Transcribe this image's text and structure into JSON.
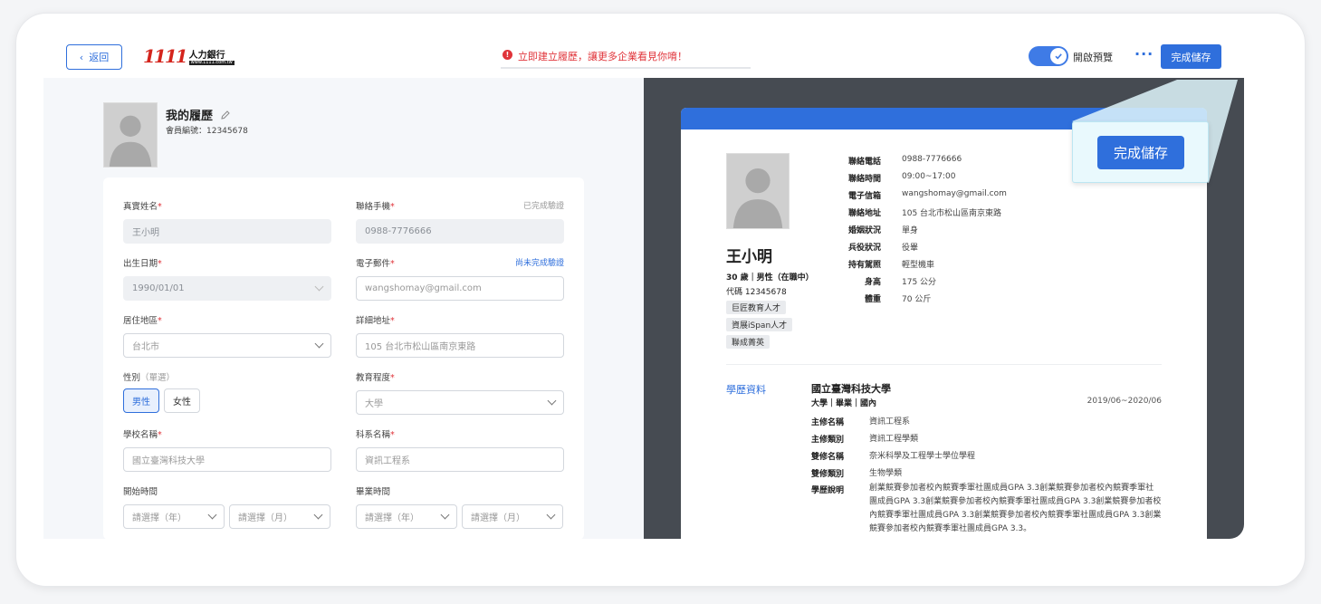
{
  "header": {
    "back_label": "返回",
    "logo_number": "1111",
    "logo_text": "人力銀行",
    "logo_url": "www.1111.com.tw",
    "notice": "立即建立履歷，讓更多企業看見你唷！",
    "preview_toggle_label": "開啟預覽",
    "preview_on": true,
    "more_label": "···",
    "save_label": "完成儲存"
  },
  "profile": {
    "title": "我的履歷",
    "member_id": "會員編號：12345678"
  },
  "form": {
    "name": {
      "label": "真實姓名",
      "value": "王小明"
    },
    "phone": {
      "label": "聯絡手機",
      "status": "已完成驗證",
      "value": "0988-7776666"
    },
    "birthday": {
      "label": "出生日期",
      "value": "1990/01/01"
    },
    "email": {
      "label": "電子郵件",
      "status": "尚未完成驗證",
      "value": "wangshomay@gmail.com"
    },
    "region": {
      "label": "居住地區",
      "value": "台北市"
    },
    "address": {
      "label": "詳細地址",
      "value": "105 台北市松山區南京東路"
    },
    "gender": {
      "label": "性別",
      "hint": "（單選）",
      "options": [
        "男性",
        "女性"
      ],
      "selected": "男性"
    },
    "education": {
      "label": "教育程度",
      "value": "大學"
    },
    "school": {
      "label": "學校名稱",
      "value": "國立臺灣科技大學"
    },
    "department": {
      "label": "科系名稱",
      "value": "資訊工程系"
    },
    "start": {
      "label": "開始時間",
      "year_placeholder": "請選擇（年）",
      "month_placeholder": "請選擇（月）"
    },
    "graduation": {
      "label": "畢業時間",
      "year_placeholder": "請選擇（年）",
      "month_placeholder": "請選擇（月）"
    }
  },
  "preview": {
    "name": "王小明",
    "summary": "30 歲｜男性（在職中）",
    "code": "代碼 12345678",
    "tags": [
      "巨匠教育人才",
      "資展iSpan人才",
      "聯成菁英"
    ],
    "info": [
      {
        "k": "聯絡電話",
        "v": "0988-7776666"
      },
      {
        "k": "聯絡時間",
        "v": "09:00~17:00"
      },
      {
        "k": "電子信箱",
        "v": "wangshomay@gmail.com"
      },
      {
        "k": "聯絡地址",
        "v": "105 台北市松山區南京東路"
      },
      {
        "k": "婚姻狀況",
        "v": "單身"
      },
      {
        "k": "兵役狀況",
        "v": "役畢"
      },
      {
        "k": "持有駕照",
        "v": "輕型機車"
      },
      {
        "k": "身高",
        "v": "175 公分"
      },
      {
        "k": "體重",
        "v": "70 公斤"
      }
    ],
    "education_title": "學歷資料",
    "school": "國立臺灣科技大學",
    "school_sub": "大學｜畢業｜國內",
    "school_date": "2019/06~2020/06",
    "edu_rows": [
      {
        "k": "主修名稱",
        "v": "資訊工程系"
      },
      {
        "k": "主修類別",
        "v": "資訊工程學類"
      },
      {
        "k": "雙修名稱",
        "v": "奈米科學及工程學士學位學程"
      },
      {
        "k": "雙修類別",
        "v": "生物學類"
      },
      {
        "k": "學歷說明",
        "v": "創業競賽參加者校內競賽季軍社團成員GPA 3.3創業競賽參加者校內競賽季軍社團成員GPA 3.3創業競賽參加者校內競賽季軍社團成員GPA 3.3創業競賽參加者校內競賽季軍社團成員GPA 3.3創業競賽參加者校內競賽季軍社團成員GPA 3.3創業競賽參加者校內競賽季軍社團成員GPA 3.3。"
      }
    ]
  },
  "callout": {
    "save_label": "完成儲存"
  },
  "colors": {
    "primary": "#2f6fdc",
    "alert": "#e0343a",
    "preview_bg": "#464b52",
    "callout_bg": "#e9f9fd"
  }
}
